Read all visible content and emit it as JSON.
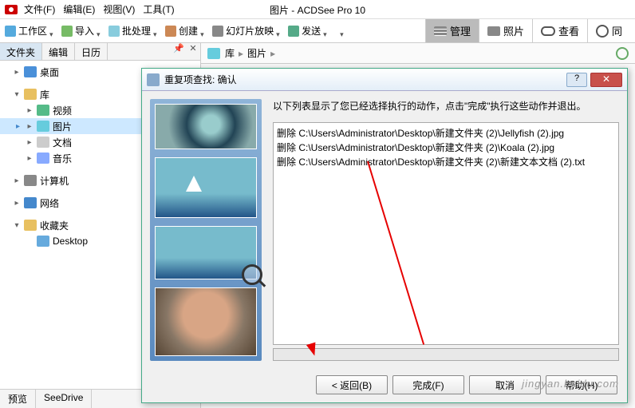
{
  "windowTitle": "图片 - ACDSee Pro 10",
  "menu": {
    "file": "文件(F)",
    "edit": "编辑(E)",
    "view": "视图(V)",
    "tools": "工具(T)"
  },
  "toolbar": {
    "workspace": "工作区",
    "import": "导入",
    "batch": "批处理",
    "create": "创建",
    "slideshow": "幻灯片放映",
    "send": "发送"
  },
  "rightTabs": {
    "manage": "管理",
    "photo": "照片",
    "view": "查看",
    "sync": "同"
  },
  "panelTabs": {
    "folders": "文件夹",
    "edit": "编辑",
    "calendar": "日历"
  },
  "tree": {
    "desktop": "桌面",
    "library": "库",
    "video": "视频",
    "pictures": "图片",
    "documents": "文档",
    "music": "音乐",
    "computer": "计算机",
    "network": "网络",
    "favorites": "收藏夹",
    "favDesktop": "Desktop"
  },
  "bottomTabs": {
    "preview": "预览",
    "seedrive": "SeeDrive"
  },
  "breadcrumb": {
    "lib": "库",
    "pics": "图片"
  },
  "dialog": {
    "title": "重复项查找: 确认",
    "message": "以下列表显示了您已经选择执行的动作，点击\"完成\"执行这些动作并退出。",
    "rows": [
      "删除 C:\\Users\\Administrator\\Desktop\\新建文件夹 (2)\\Jellyfish (2).jpg",
      "删除 C:\\Users\\Administrator\\Desktop\\新建文件夹 (2)\\Koala (2).jpg",
      "删除 C:\\Users\\Administrator\\Desktop\\新建文件夹 (2)\\新建文本文档 (2).txt"
    ],
    "back": "< 返回(B)",
    "finish": "完成(F)",
    "cancel": "取消",
    "help": "帮助(H)",
    "helpIcon": "?",
    "closeIcon": "✕"
  },
  "watermark": "jingyan.baidu.com"
}
